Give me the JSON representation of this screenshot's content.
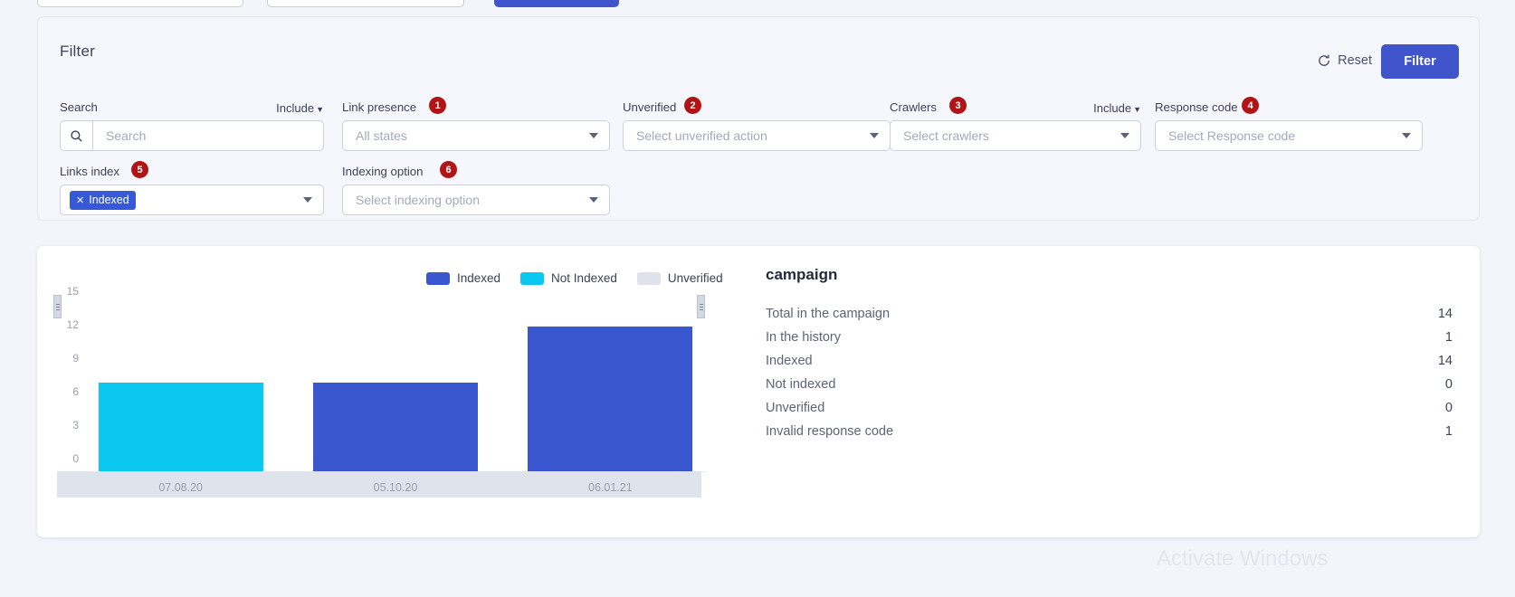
{
  "filter": {
    "title": "Filter",
    "reset_label": "Reset",
    "submit_label": "Filter",
    "fields": [
      {
        "label": "Search",
        "badge": "",
        "include": "Include",
        "placeholder": "Search",
        "icon": "search-icon",
        "type": "search"
      },
      {
        "label": "Link presence",
        "badge": "1",
        "include": "",
        "placeholder": "All states",
        "icon": "chevron-down-icon",
        "type": "select"
      },
      {
        "label": "Unverified",
        "badge": "2",
        "include": "",
        "placeholder": "Select unverified action",
        "icon": "chevron-down-icon",
        "type": "select"
      },
      {
        "label": "Crawlers",
        "badge": "3",
        "include": "Include",
        "placeholder": "Select crawlers",
        "icon": "chevron-down-icon",
        "type": "select"
      },
      {
        "label": "Response code",
        "badge": "4",
        "include": "",
        "placeholder": "Select Response code",
        "icon": "chevron-down-icon",
        "type": "select"
      },
      {
        "label": "Links index",
        "badge": "5",
        "include": "",
        "placeholder": "",
        "icon": "chevron-down-icon",
        "type": "tags",
        "tags": [
          "Indexed"
        ]
      },
      {
        "label": "Indexing option",
        "badge": "6",
        "include": "",
        "placeholder": "Select indexing option",
        "icon": "chevron-down-icon",
        "type": "select"
      }
    ],
    "badge_color": "#b01414",
    "accent_color": "#4055cc"
  },
  "chart_data": {
    "type": "bar",
    "title": "",
    "xlabel": "",
    "ylabel": "",
    "categories": [
      "07.08.20",
      "05.10.20",
      "06.01.21"
    ],
    "ylim": [
      0,
      16
    ],
    "yticks": [
      15,
      12,
      9,
      6,
      3,
      0
    ],
    "grid": false,
    "legend_position": "top-center",
    "legend": [
      {
        "name": "Indexed",
        "color": "#3b57d0"
      },
      {
        "name": "Not Indexed",
        "color": "#0ac8f0"
      },
      {
        "name": "Unverified",
        "color": "#dfe2eb"
      }
    ],
    "series": [
      {
        "name": "Indexed",
        "color": "#3b57d0",
        "values": [
          0,
          8,
          13
        ]
      },
      {
        "name": "Not Indexed",
        "color": "#0ac8f0",
        "values": [
          8,
          0,
          0
        ]
      },
      {
        "name": "Unverified",
        "color": "#dfe2eb",
        "values": [
          0,
          0,
          0
        ]
      }
    ],
    "bars": [
      {
        "category": "07.08.20",
        "value": 8,
        "series": "Not Indexed",
        "color": "#0ac8f0"
      },
      {
        "category": "05.10.20",
        "value": 8,
        "series": "Indexed",
        "color": "#3b57d0"
      },
      {
        "category": "06.01.21",
        "value": 13,
        "series": "Indexed",
        "color": "#3b57d0"
      }
    ]
  },
  "stats": {
    "title": "campaign",
    "rows": [
      {
        "label": "Total in the campaign",
        "value": "14"
      },
      {
        "label": "In the history",
        "value": "1"
      },
      {
        "label": "Indexed",
        "value": "14"
      },
      {
        "label": "Not indexed",
        "value": "0"
      },
      {
        "label": "Unverified",
        "value": "0"
      },
      {
        "label": "Invalid response code",
        "value": "1"
      }
    ]
  },
  "watermark": "Activate Windows"
}
